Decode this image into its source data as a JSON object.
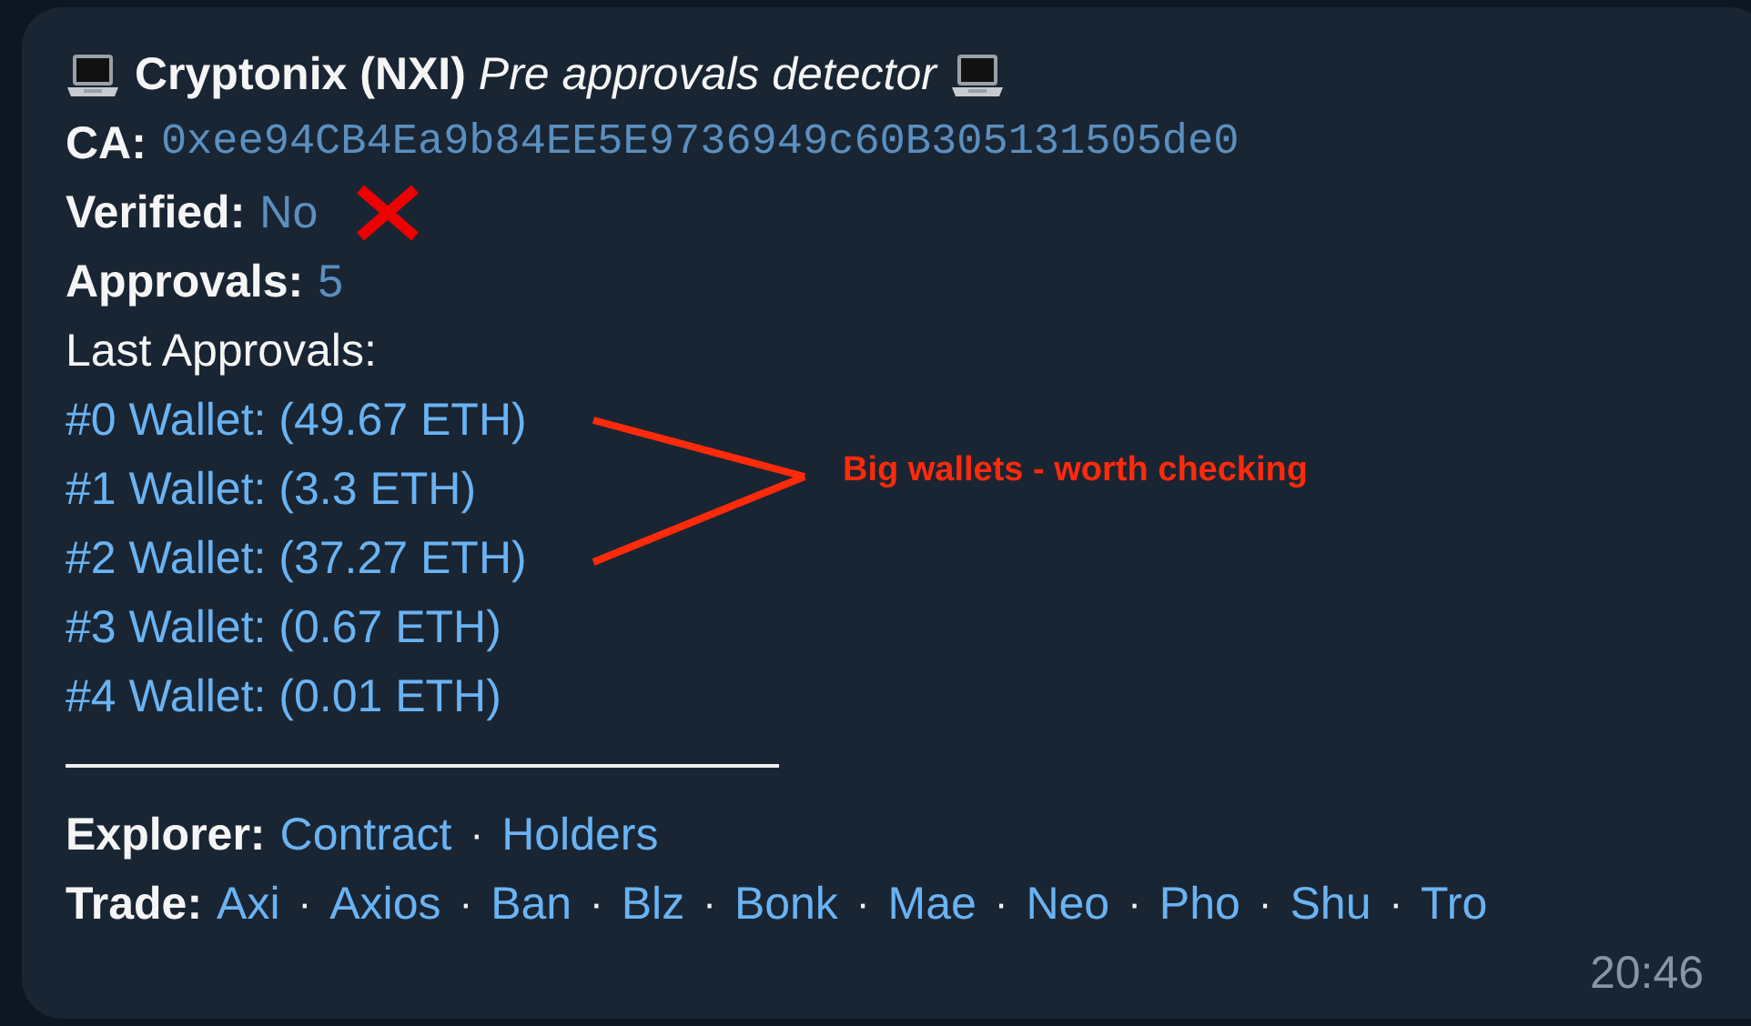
{
  "title": {
    "name": "Cryptonix (NXI)",
    "subtitle": "Pre approvals detector"
  },
  "fields": [
    {
      "label": "CA:",
      "value": "0xee94CB4Ea9b84EE5E9736949c60B305131505de0",
      "kind": "code"
    },
    {
      "label": "Verified:",
      "value": "No",
      "kind": "cross"
    },
    {
      "label": "Approvals:",
      "value": "5",
      "kind": "plain"
    }
  ],
  "last_approvals_label": "Last Approvals:",
  "wallets": [
    "#0 Wallet: (49.67 ETH)",
    "#1 Wallet: (3.3 ETH)",
    "#2 Wallet: (37.27 ETH)",
    "#3 Wallet: (0.67 ETH)",
    "#4 Wallet: (0.01 ETH)"
  ],
  "separator": "·",
  "link_rows": [
    {
      "label": "Explorer:",
      "links": [
        "Contract",
        "Holders"
      ]
    },
    {
      "label": "Trade:",
      "links": [
        "Axi",
        "Axios",
        "Ban",
        "Blz",
        "Bonk",
        "Mae",
        "Neo",
        "Pho",
        "Shu",
        "Tro"
      ]
    }
  ],
  "time": "20:46",
  "annotation": {
    "text": "Big wallets - worth checking"
  }
}
